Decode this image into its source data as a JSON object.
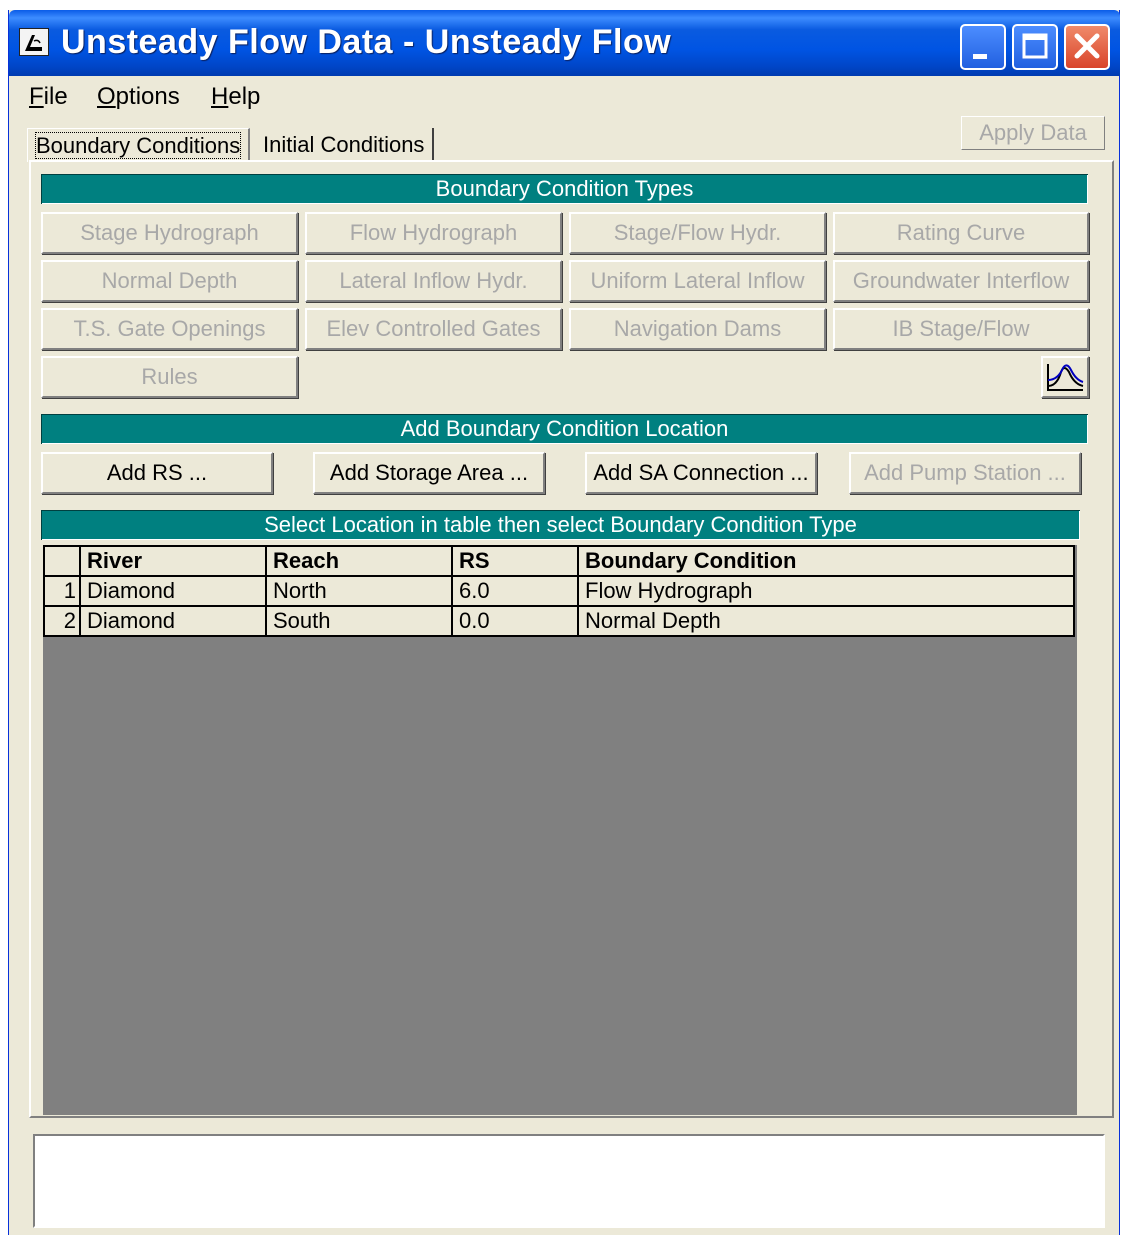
{
  "window": {
    "title": "Unsteady Flow Data - Unsteady Flow",
    "icon": "hecras-app-icon"
  },
  "menu": {
    "items": [
      "File",
      "Options",
      "Help"
    ],
    "mnemonics": [
      "F",
      "O",
      "H"
    ]
  },
  "tabs": {
    "boundary": "Boundary Conditions",
    "initial": "Initial Conditions",
    "active": "Boundary Conditions"
  },
  "apply_button": "Apply Data",
  "bc_types": {
    "header": "Boundary Condition Types",
    "buttons": [
      {
        "label": "Stage Hydrograph",
        "enabled": false
      },
      {
        "label": "Flow Hydrograph",
        "enabled": false
      },
      {
        "label": "Stage/Flow Hydr.",
        "enabled": false
      },
      {
        "label": "Rating Curve",
        "enabled": false
      },
      {
        "label": "Normal Depth",
        "enabled": false
      },
      {
        "label": "Lateral Inflow Hydr.",
        "enabled": false
      },
      {
        "label": "Uniform Lateral Inflow",
        "enabled": false
      },
      {
        "label": "Groundwater Interflow",
        "enabled": false
      },
      {
        "label": "T.S. Gate Openings",
        "enabled": false
      },
      {
        "label": "Elev Controlled Gates",
        "enabled": false
      },
      {
        "label": "Navigation Dams",
        "enabled": false
      },
      {
        "label": "IB Stage/Flow",
        "enabled": false
      },
      {
        "label": "Rules",
        "enabled": false
      }
    ],
    "plot_button_icon": "hydrograph-plot-icon"
  },
  "add_location": {
    "header": "Add Boundary Condition Location",
    "buttons": [
      {
        "label": "Add RS ...",
        "enabled": true
      },
      {
        "label": "Add Storage Area ...",
        "enabled": true
      },
      {
        "label": "Add SA Connection ...",
        "enabled": true
      },
      {
        "label": "Add Pump Station ...",
        "enabled": false
      }
    ]
  },
  "table": {
    "header": "Select Location in table then select Boundary Condition Type",
    "columns": [
      "River",
      "Reach",
      "RS",
      "Boundary Condition"
    ],
    "rows": [
      {
        "num": "1",
        "river": "Diamond",
        "reach": "North",
        "rs": "6.0",
        "bc": "Flow Hydrograph"
      },
      {
        "num": "2",
        "river": "Diamond",
        "reach": "South",
        "rs": "0.0",
        "bc": "Normal Depth"
      }
    ]
  },
  "status": "",
  "colors": {
    "accent_header": "#008080",
    "window_bg": "#ece9d8",
    "grid_empty": "#808080",
    "title_bar": "#0054e3",
    "close_button": "#d9442a"
  }
}
